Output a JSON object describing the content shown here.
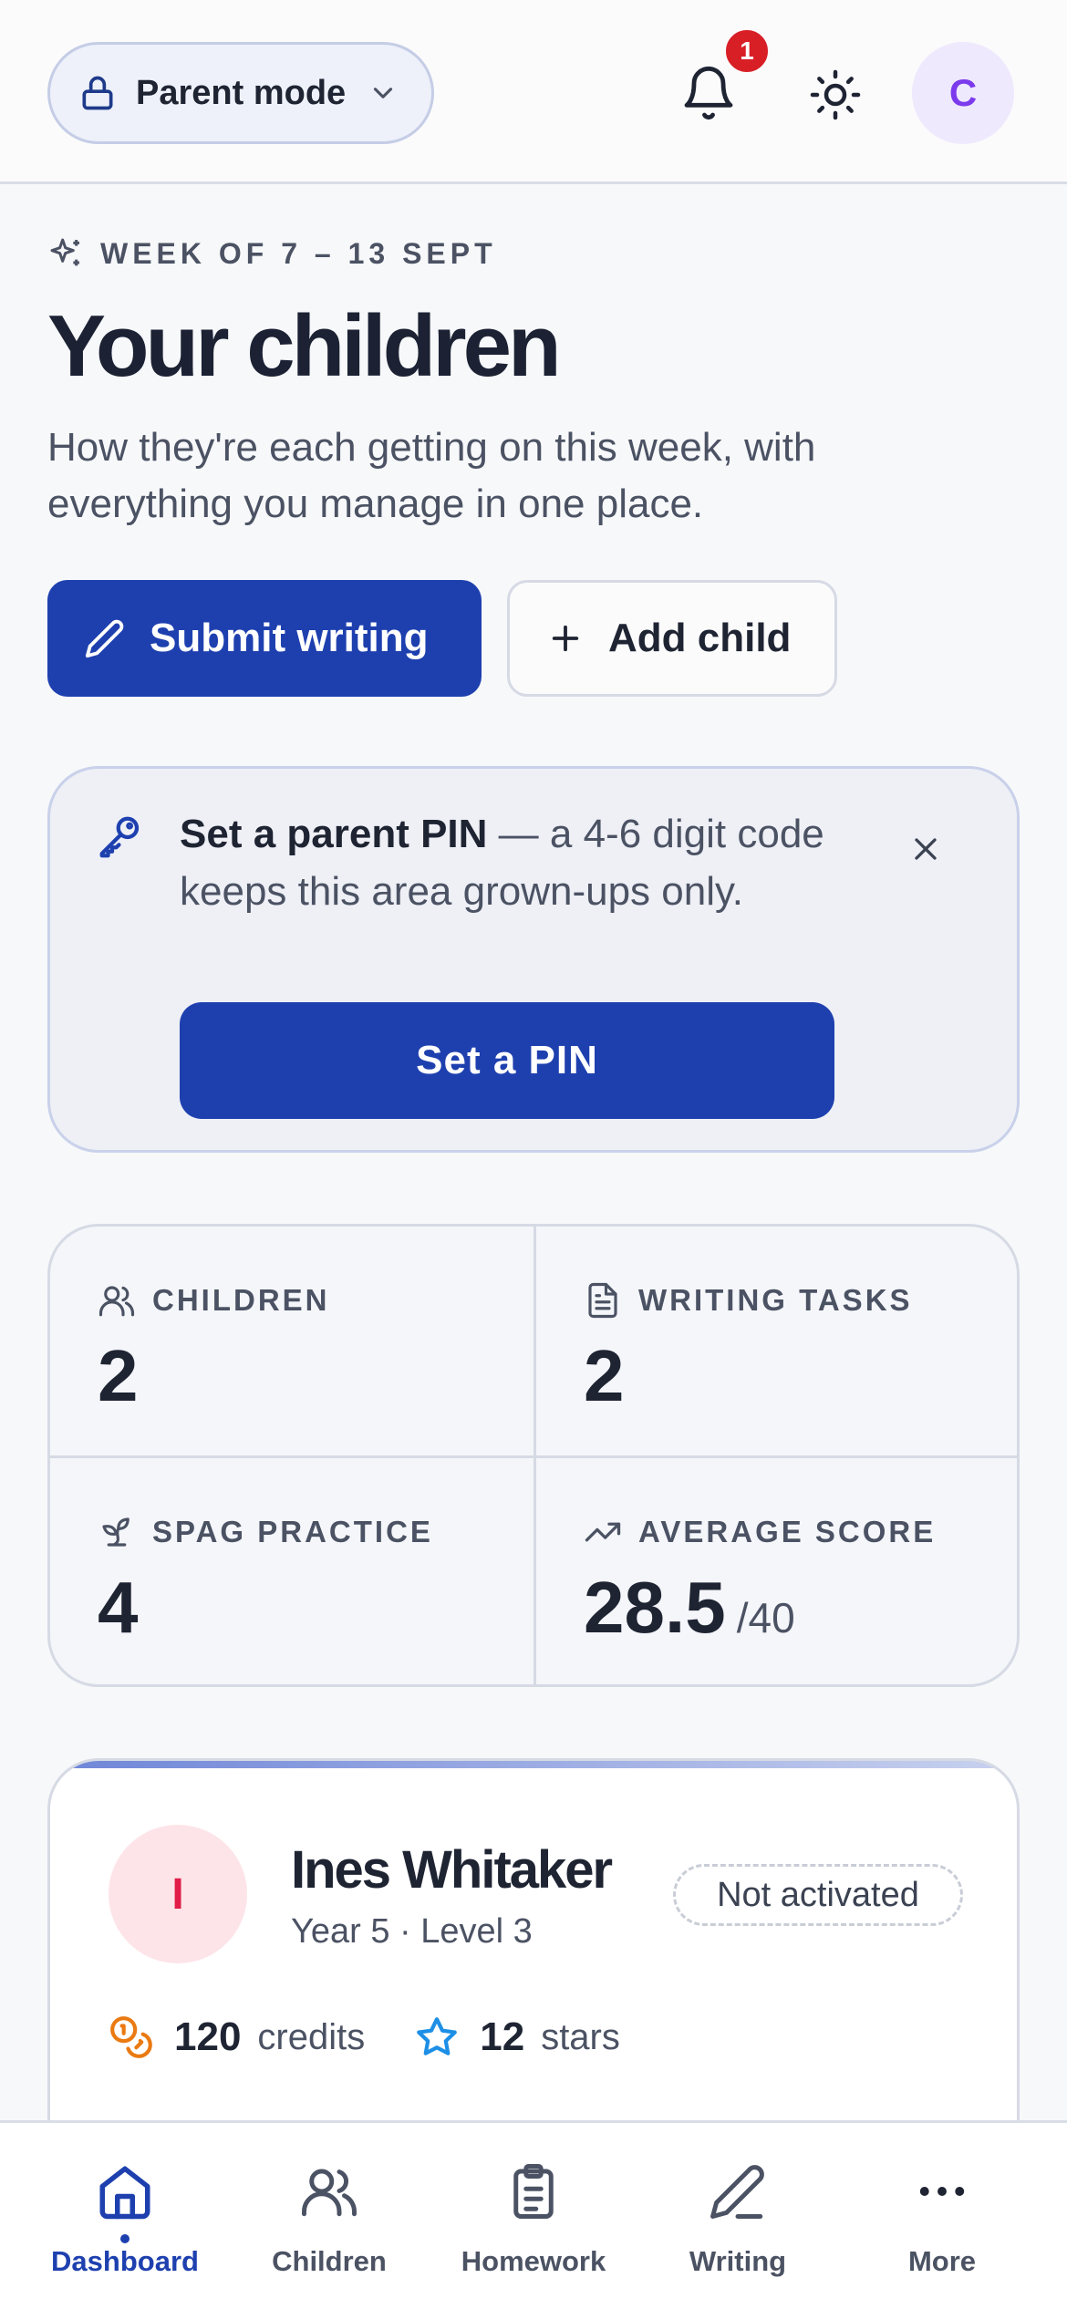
{
  "top_bar": {
    "mode_label": "Parent mode",
    "notification_count": "1",
    "avatar_initial": "C"
  },
  "hero": {
    "eyebrow": "WEEK OF 7 – 13 SEPT",
    "title": "Your children",
    "subtitle": "How they're each getting on this week, with everything you manage in one place.",
    "primary_button": "Submit writing",
    "secondary_button": "Add child"
  },
  "pin_card": {
    "bold": "Set a parent PIN",
    "rest": " — a 4-6 digit code keeps this area grown-ups only.",
    "button": "Set a PIN"
  },
  "stats": [
    {
      "label": "CHILDREN",
      "value": "2",
      "suffix": "",
      "icon": "users-icon"
    },
    {
      "label": "WRITING TASKS",
      "value": "2",
      "suffix": "",
      "icon": "document-icon"
    },
    {
      "label": "SPAG PRACTICE",
      "value": "4",
      "suffix": "",
      "icon": "sprout-icon"
    },
    {
      "label": "AVERAGE SCORE",
      "value": "28.5",
      "suffix": "/40",
      "icon": "trending-up-icon"
    }
  ],
  "child": {
    "initial": "I",
    "name": "Ines Whitaker",
    "meta": "Year 5 · Level 3",
    "status": "Not activated",
    "credits_value": "120",
    "credits_unit": "credits",
    "stars_value": "12",
    "stars_unit": "stars"
  },
  "bottom_nav": [
    {
      "label": "Dashboard",
      "icon": "home-icon",
      "active": true
    },
    {
      "label": "Children",
      "icon": "users-icon",
      "active": false
    },
    {
      "label": "Homework",
      "icon": "clipboard-icon",
      "active": false
    },
    {
      "label": "Writing",
      "icon": "pencil-icon",
      "active": false
    },
    {
      "label": "More",
      "icon": "more-dots-icon",
      "active": false
    }
  ],
  "colors": {
    "primary": "#1e40af",
    "badge": "#d81f26",
    "avatar_top_bg": "#efe9fd",
    "avatar_top_text": "#7c3aed",
    "child_avatar_bg": "#fde4e8",
    "child_avatar_text": "#e11d48",
    "credits_icon": "#ea7a12",
    "stars_icon": "#1d8fe6"
  }
}
